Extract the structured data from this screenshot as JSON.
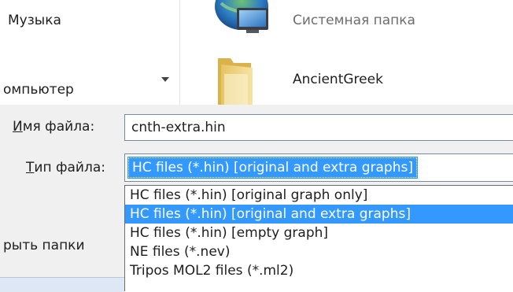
{
  "sidebar": {
    "items": [
      {
        "label": "Музыка"
      },
      {
        "label": "омпьютер"
      }
    ],
    "hide_folders_label": "рыть папки"
  },
  "file_list": {
    "items": [
      {
        "name": "Системная папка",
        "icon": "network-computer-icon"
      },
      {
        "name": "AncientGreek",
        "icon": "folder-icon"
      }
    ]
  },
  "form": {
    "filename_label_accel": "И",
    "filename_label_rest": "мя файла:",
    "filename_value": "cnth-extra.hin",
    "filetype_label_accel": "Т",
    "filetype_label_rest": "ип файла:",
    "filetype_selected": "HC files (*.hin) [original and extra graphs]",
    "filetype_options": [
      {
        "label": "HC files (*.hin) [original graph only]"
      },
      {
        "label": "HC files (*.hin) [original and extra graphs]",
        "selected": true
      },
      {
        "label": "HC files (*.hin) [empty graph]"
      },
      {
        "label": "NE files (*.nev)"
      },
      {
        "label": "Tripos MOL2 files (*.ml2)"
      }
    ]
  },
  "colors": {
    "selection": "#3399ff",
    "form_background": "#f0f0f0"
  }
}
